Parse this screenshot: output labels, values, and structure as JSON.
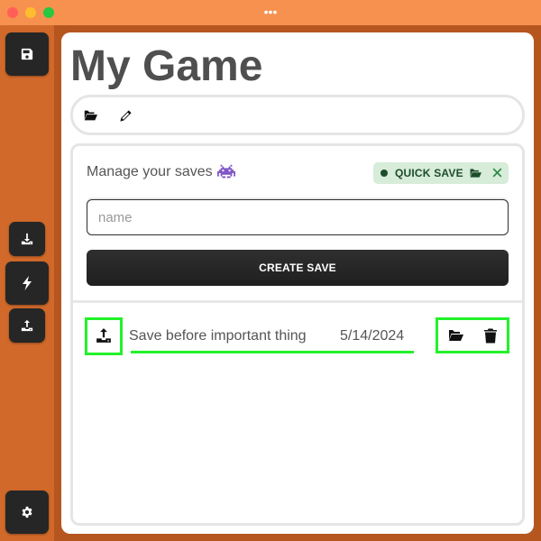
{
  "window": {
    "menu_dots": "•••"
  },
  "sidebar": {
    "items": [
      {
        "name": "save",
        "icon": "floppy-disk-icon"
      },
      {
        "name": "download",
        "icon": "download-icon"
      },
      {
        "name": "quick",
        "icon": "bolt-icon"
      },
      {
        "name": "upload",
        "icon": "upload-icon"
      },
      {
        "name": "settings",
        "icon": "gear-icon"
      }
    ]
  },
  "header": {
    "title": "My Game"
  },
  "toolbar": {
    "icons": [
      "folder-open-icon",
      "pencil-icon"
    ]
  },
  "saves": {
    "manage_label": "Manage your saves",
    "emoji": "space-invader-icon",
    "quick_save": {
      "label": "QUICK SAVE",
      "icons": [
        "folder-open-icon",
        "close-icon"
      ]
    },
    "name_input": {
      "placeholder": "name",
      "value": ""
    },
    "create_button_label": "CREATE SAVE",
    "list": [
      {
        "name": "Save before important thing",
        "date": "5/14/2024"
      }
    ]
  },
  "colors": {
    "titlebar": "#f79150",
    "sidebar": "#d0692a",
    "background": "#b6561f",
    "highlight": "#22f22a",
    "quick_save_bg": "#d7ecd9",
    "quick_save_fg": "#1d4d2b"
  }
}
